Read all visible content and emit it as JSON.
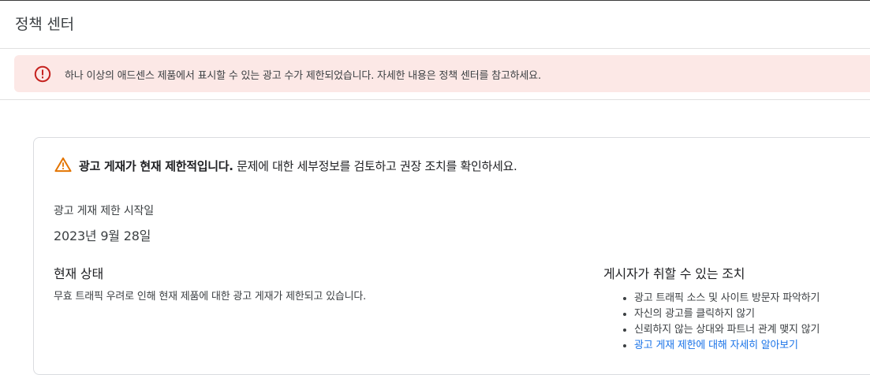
{
  "header": {
    "title": "정책 센터"
  },
  "alert": {
    "icon": "error-circle-icon",
    "color": "#c5221f",
    "background": "#fce8e6",
    "message": "하나 이상의 애드센스 제품에서 표시할 수 있는 광고 수가 제한되었습니다. 자세한 내용은 정책 센터를 참고하세요."
  },
  "card": {
    "warning": {
      "icon": "warning-triangle-icon",
      "color": "#e37400",
      "bold_text": "광고 게재가 현재 제한적입니다.",
      "text": " 문제에 대한 세부정보를 검토하고 권장 조치를 확인하세요."
    },
    "start": {
      "label": "광고 게재 제한 시작일",
      "date": "2023년 9월 28일"
    },
    "status": {
      "heading": "현재 상태",
      "text": "무효 트래픽 우려로 인해 현재 제품에 대한 광고 게재가 제한되고 있습니다."
    },
    "actions": {
      "heading": "게시자가 취할 수 있는 조치",
      "items": [
        "광고 트래픽 소스 및 사이트 방문자 파악하기",
        "자신의 광고를 클릭하지 않기",
        "신뢰하지 않는 상대와 파트너 관계 맺지 않기"
      ],
      "link": "광고 게재 제한에 대해 자세히 알아보기",
      "link_color": "#1a73e8"
    }
  }
}
